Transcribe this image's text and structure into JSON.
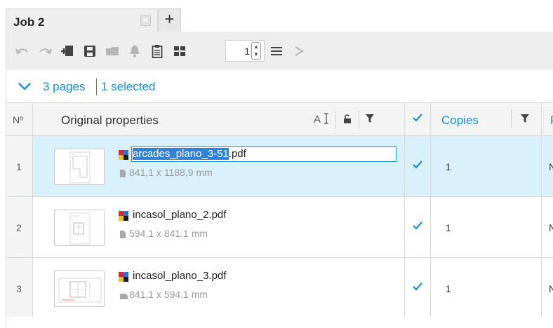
{
  "tabs": {
    "active_label": "Job 2",
    "close_icon": "close-icon",
    "add_icon": "plus-icon",
    "add_label": "+"
  },
  "toolbar": {
    "icons": [
      "undo-icon",
      "redo-icon",
      "add-file-icon",
      "save-icon",
      "folder-icon",
      "bell-icon",
      "clipboard-icon",
      "grid-icon",
      "menu-icon",
      "send-icon"
    ],
    "page_value": "1"
  },
  "selection": {
    "pages_label": "3 pages",
    "selected_label": "1 selected"
  },
  "table": {
    "headers": {
      "number": "Nº",
      "original_properties": "Original properties",
      "copies": "Copies",
      "next_partial": "P"
    },
    "rows": [
      {
        "number": "1",
        "file_name_highlighted": "arcades_plano_3-51",
        "file_name_ext": ".pdf",
        "size": "841,1 x 1188,9 mm",
        "orientation": "portrait",
        "copies": "1",
        "next_partial": "N",
        "selected": true
      },
      {
        "number": "2",
        "file_name": "incasol_plano_2.pdf",
        "size": "594,1 x 841,1 mm",
        "orientation": "portrait",
        "copies": "1",
        "next_partial": "N",
        "selected": false
      },
      {
        "number": "3",
        "file_name": "incasol_plano_3.pdf",
        "size": "841,1 x 594,1 mm",
        "orientation": "landscape",
        "copies": "1",
        "next_partial": "N",
        "selected": false
      }
    ]
  },
  "colors": {
    "accent": "#1b8fd3",
    "selected_row": "#d9f1fa",
    "toolbar_bg": "#eeeeee"
  }
}
